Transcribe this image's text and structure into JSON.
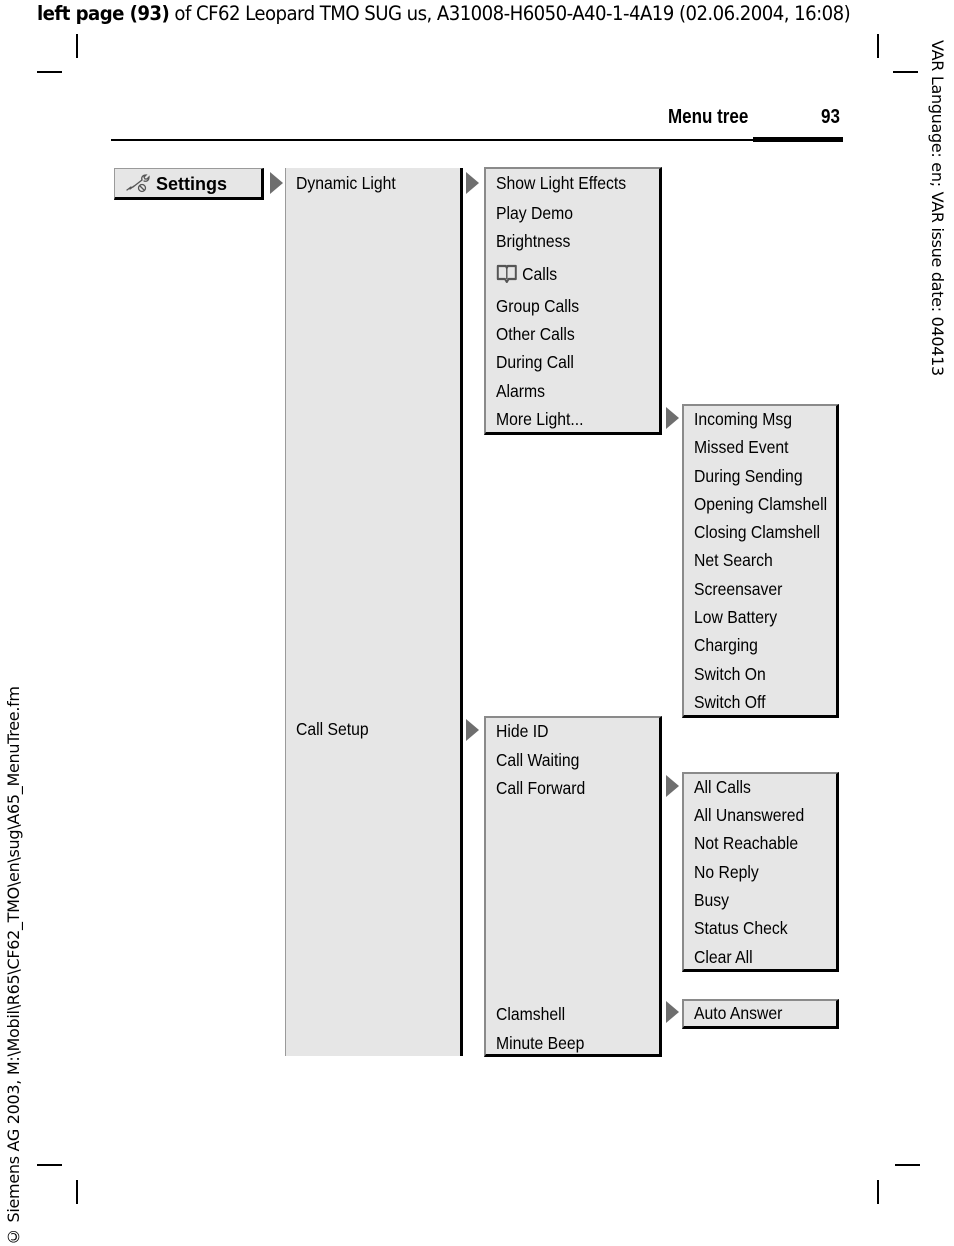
{
  "top_line": {
    "bold": "left page (93)",
    "rest": " of CF62 Leopard TMO SUG us, A31008-H6050-A40-1-4A19 (02.06.2004, 16:08)"
  },
  "side_right": "VAR Language: en; VAR issue date: 040413",
  "side_left": "© Siemens AG 2003, M:\\Mobil\\R65\\CF62_TMO\\en\\sug\\A65_MenuTree.fm",
  "header": {
    "title": "Menu tree",
    "page_number": "93"
  },
  "menu": {
    "root": {
      "label": "Settings",
      "icon": "wrench-icon"
    },
    "level2": [
      {
        "label": "Dynamic Light"
      },
      {
        "label": "Call Setup"
      }
    ],
    "dynamic_light": [
      "Show Light Effects",
      "Play Demo",
      "Brightness",
      "Calls",
      "Group Calls",
      "Other Calls",
      "During Call",
      "Alarms",
      "More Light..."
    ],
    "dynamic_light_icons": {
      "Calls": "phonebook-icon"
    },
    "more_light": [
      "Incoming Msg",
      "Missed Event",
      "During Sending",
      "Opening Clamshell",
      "Closing Clamshell",
      "Net Search",
      "Screensaver",
      "Low Battery",
      "Charging",
      "Switch On",
      "Switch Off"
    ],
    "call_setup": [
      "Hide ID",
      "Call Waiting",
      "Call Forward",
      "Clamshell",
      "Minute Beep"
    ],
    "call_forward": [
      "All Calls",
      "All Unanswered",
      "Not Reachable",
      "No Reply",
      "Busy",
      "Status Check",
      "Clear All"
    ],
    "clamshell": [
      "Auto Answer"
    ]
  }
}
